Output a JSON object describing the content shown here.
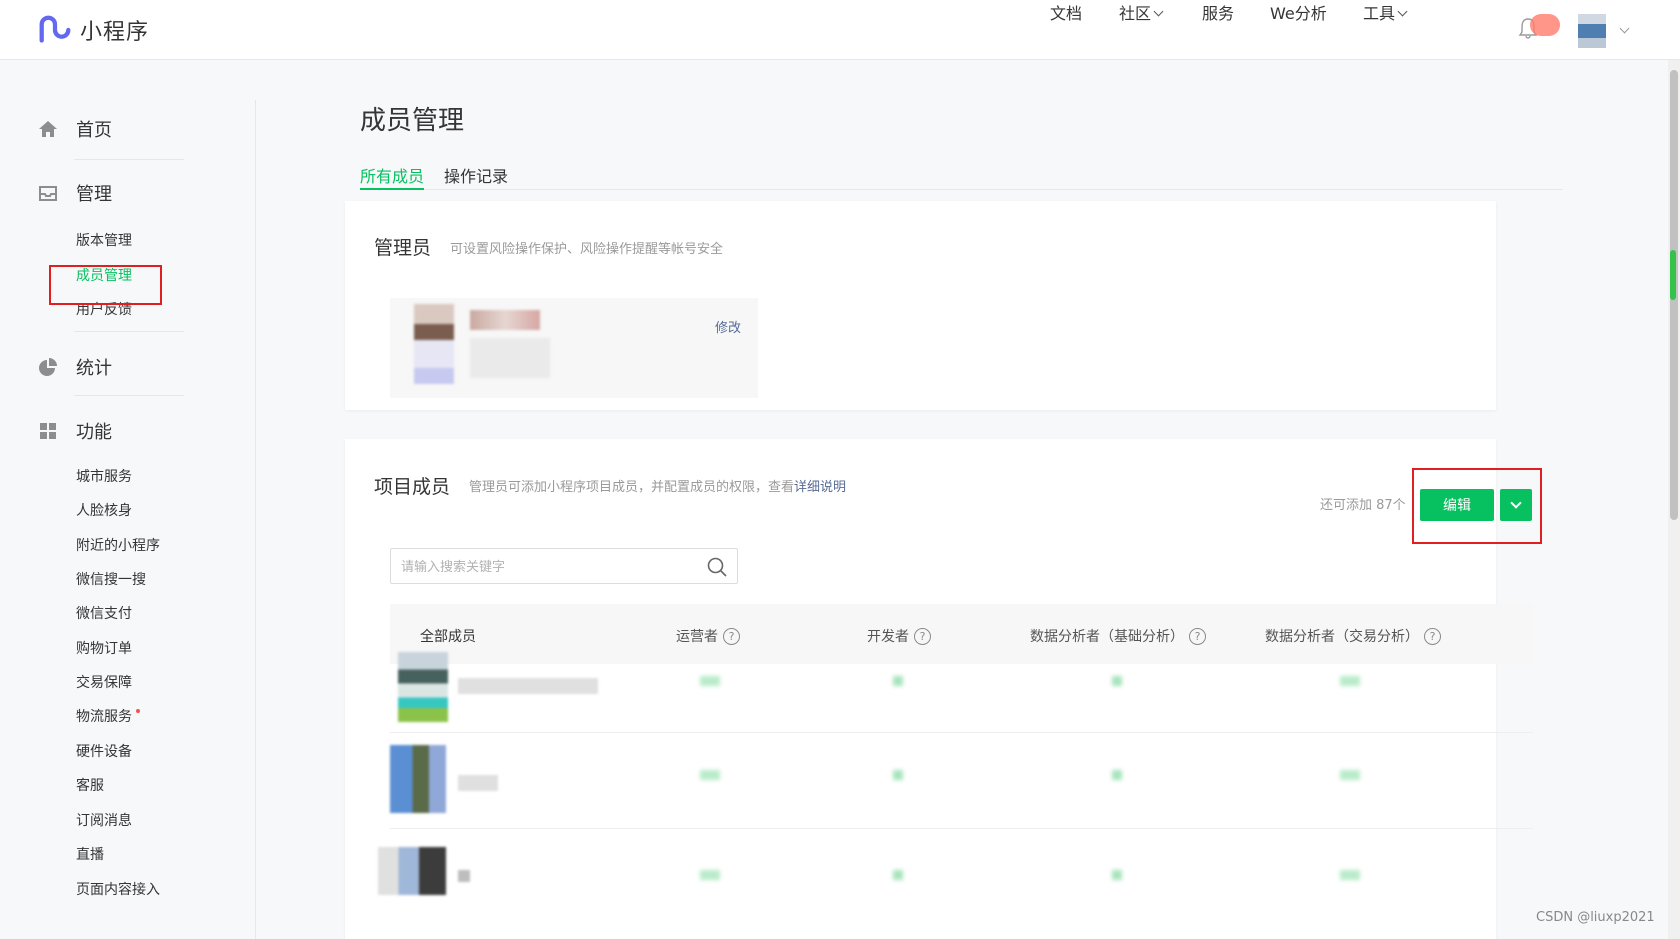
{
  "app": {
    "title": "小程序"
  },
  "topnav": {
    "items": [
      {
        "label": "文档",
        "has_dropdown": false
      },
      {
        "label": "社区",
        "has_dropdown": true
      },
      {
        "label": "服务",
        "has_dropdown": false
      },
      {
        "label": "We分析",
        "has_dropdown": false
      },
      {
        "label": "工具",
        "has_dropdown": true
      }
    ],
    "icons": [
      "bell-icon",
      "avatar"
    ]
  },
  "sidebar": {
    "home": "首页",
    "manage": {
      "label": "管理",
      "items": [
        {
          "label": "版本管理",
          "active": false
        },
        {
          "label": "成员管理",
          "active": true
        },
        {
          "label": "用户反馈",
          "active": false
        }
      ]
    },
    "stats": "统计",
    "features": {
      "label": "功能",
      "items": [
        {
          "label": "城市服务"
        },
        {
          "label": "人脸核身"
        },
        {
          "label": "附近的小程序"
        },
        {
          "label": "微信搜一搜"
        },
        {
          "label": "微信支付"
        },
        {
          "label": "购物订单"
        },
        {
          "label": "交易保障"
        },
        {
          "label": "物流服务",
          "dot": true
        },
        {
          "label": "硬件设备"
        },
        {
          "label": "客服"
        },
        {
          "label": "订阅消息"
        },
        {
          "label": "直播"
        },
        {
          "label": "页面内容接入"
        }
      ]
    }
  },
  "main": {
    "title": "成员管理",
    "tabs": [
      {
        "label": "所有成员",
        "active": true
      },
      {
        "label": "操作记录",
        "active": false
      }
    ],
    "admin_card": {
      "title": "管理员",
      "desc": "可设置风险操作保护、风险操作提醒等帐号安全",
      "edit_label": "修改"
    },
    "members_card": {
      "title": "项目成员",
      "desc": "管理员可添加小程序项目成员，并配置成员的权限，查看",
      "desc_link": "详细说明",
      "remaining": "还可添加 87个",
      "edit_button": "编辑",
      "search_placeholder": "请输入搜索关键字",
      "columns": [
        {
          "label": "全部成员",
          "help": false
        },
        {
          "label": "运营者",
          "help": true
        },
        {
          "label": "开发者",
          "help": true
        },
        {
          "label": "数据分析者（基础分析）",
          "help": true
        },
        {
          "label": "数据分析者（交易分析）",
          "help": true
        }
      ]
    }
  },
  "watermark": "CSDN @liuxp2021",
  "colors": {
    "accent": "#07c160",
    "link": "#576b95",
    "highlight_box": "#e02020"
  }
}
